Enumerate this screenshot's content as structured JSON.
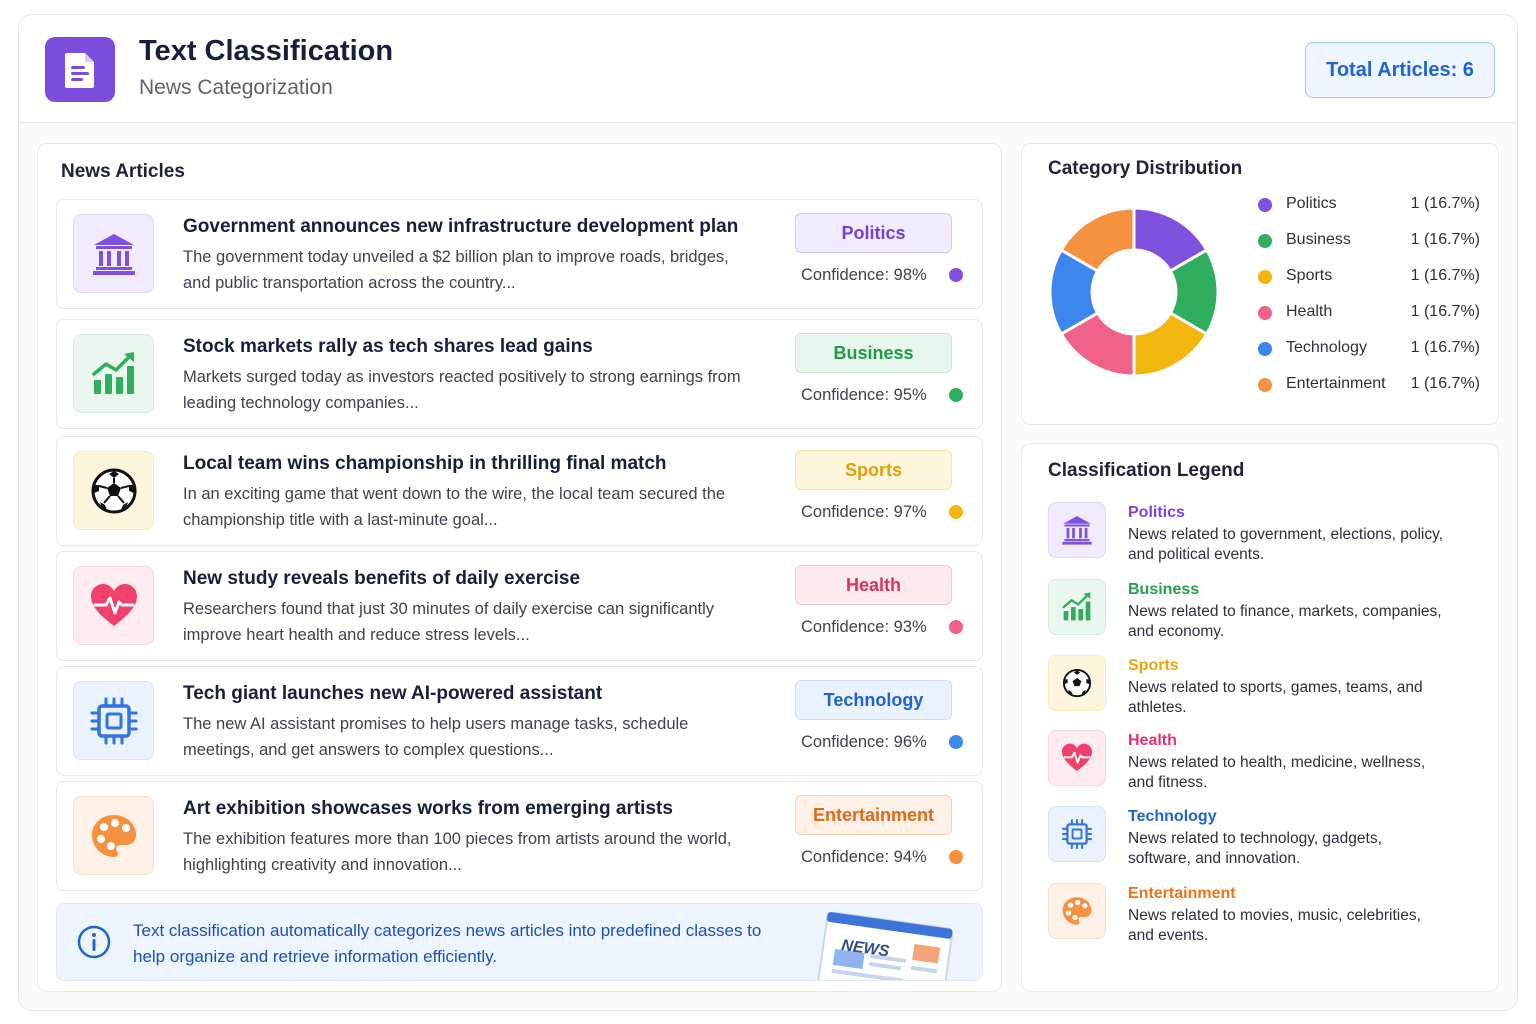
{
  "header": {
    "title": "Text Classification",
    "subtitle": "News Categorization",
    "total_badge": "Total Articles: 6"
  },
  "colors": {
    "politics": "#8050df",
    "business": "#2fae5f",
    "sports": "#f2b60f",
    "health": "#f0628a",
    "technology": "#3d86ec",
    "entertainment": "#f5913f",
    "brand": "#7c4ddd"
  },
  "articles_panel": {
    "title": "News Articles",
    "articles": [
      {
        "icon": "government-building-icon",
        "title": "Government announces new infrastructure development plan",
        "summary": "The government today unveiled a $2 billion plan to improve roads, bridges, and public transportation across the country...",
        "category": "Politics",
        "confidence": "Confidence: 98%"
      },
      {
        "icon": "chart-growth-icon",
        "title": "Stock markets rally as tech shares lead gains",
        "summary": "Markets surged today as investors reacted positively to strong earnings from leading technology companies...",
        "category": "Business",
        "confidence": "Confidence: 95%"
      },
      {
        "icon": "soccer-ball-icon",
        "title": "Local team wins championship in thrilling final match",
        "summary": "In an exciting game that went down to the wire, the local team secured the championship title with a last-minute goal...",
        "category": "Sports",
        "confidence": "Confidence: 97%"
      },
      {
        "icon": "heart-pulse-icon",
        "title": "New study reveals benefits of daily exercise",
        "summary": "Researchers found that just 30 minutes of daily exercise can significantly improve heart health and reduce stress levels...",
        "category": "Health",
        "confidence": "Confidence: 93%"
      },
      {
        "icon": "cpu-chip-icon",
        "title": "Tech giant launches new AI-powered assistant",
        "summary": "The new AI assistant promises to help users manage tasks, schedule meetings, and get answers to complex questions...",
        "category": "Technology",
        "confidence": "Confidence: 96%"
      },
      {
        "icon": "paint-palette-icon",
        "title": "Art exhibition showcases works from emerging artists",
        "summary": "The exhibition features more than 100 pieces from artists around the world, highlighting creativity and innovation...",
        "category": "Entertainment",
        "confidence": "Confidence: 94%"
      }
    ],
    "info_text": "Text classification automatically categorizes news articles into predefined classes to help organize and retrieve information efficiently.",
    "news_label": "NEWS"
  },
  "distribution_panel": {
    "title": "Category Distribution",
    "rows": [
      {
        "name": "Politics",
        "value": "1 (16.7%)"
      },
      {
        "name": "Business",
        "value": "1 (16.7%)"
      },
      {
        "name": "Sports",
        "value": "1 (16.7%)"
      },
      {
        "name": "Health",
        "value": "1 (16.7%)"
      },
      {
        "name": "Technology",
        "value": "1 (16.7%)"
      },
      {
        "name": "Entertainment",
        "value": "1 (16.7%)"
      }
    ]
  },
  "chart_data": {
    "type": "pie",
    "categories": [
      "Politics",
      "Business",
      "Sports",
      "Health",
      "Technology",
      "Entertainment"
    ],
    "values": [
      1,
      1,
      1,
      1,
      1,
      1
    ],
    "colors": [
      "#8050df",
      "#2fae5f",
      "#f2b60f",
      "#f0628a",
      "#3d86ec",
      "#f5913f"
    ],
    "title": "Category Distribution",
    "donut": true
  },
  "legend_panel": {
    "title": "Classification Legend",
    "items": [
      {
        "name": "Politics",
        "description": "News related to government, elections, policy, and political events."
      },
      {
        "name": "Business",
        "description": "News related to finance, markets, companies, and economy."
      },
      {
        "name": "Sports",
        "description": "News related to sports, games, teams, and athletes."
      },
      {
        "name": "Health",
        "description": "News related to health, medicine, wellness, and fitness."
      },
      {
        "name": "Technology",
        "description": "News related to technology, gadgets, software, and innovation."
      },
      {
        "name": "Entertainment",
        "description": "News related to movies, music, celebrities, and events."
      }
    ]
  }
}
